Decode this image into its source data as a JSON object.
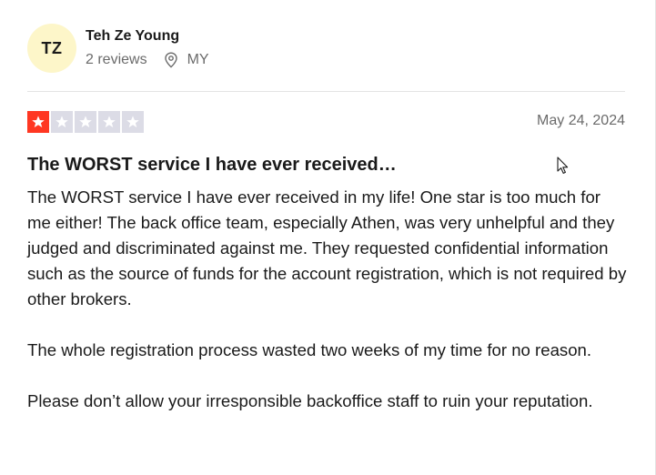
{
  "reviewer": {
    "initials": "TZ",
    "name": "Teh Ze Young",
    "reviews_count": "2 reviews",
    "location": "MY",
    "location_icon": "map-pin-icon"
  },
  "review": {
    "rating": 1,
    "max_rating": 5,
    "rating_color": "#ff3722",
    "date": "May 24, 2024",
    "title": "The WORST service I have ever received…",
    "paragraphs": [
      "The WORST service I have ever received in my life! One star is too much for me either! The back office team, especially Athen, was very unhelpful and they judged and discriminated against me. They requested confidential information such as the source of funds for the account registration, which is not required by other brokers.",
      "The whole registration process wasted two weeks of my time for no reason.",
      "Please don’t allow your irresponsible backoffice staff to ruin your reputation."
    ]
  },
  "colors": {
    "avatar_bg": "#fdf6c9",
    "star_empty": "#dcdce6",
    "muted_text": "#6b6b6b"
  }
}
